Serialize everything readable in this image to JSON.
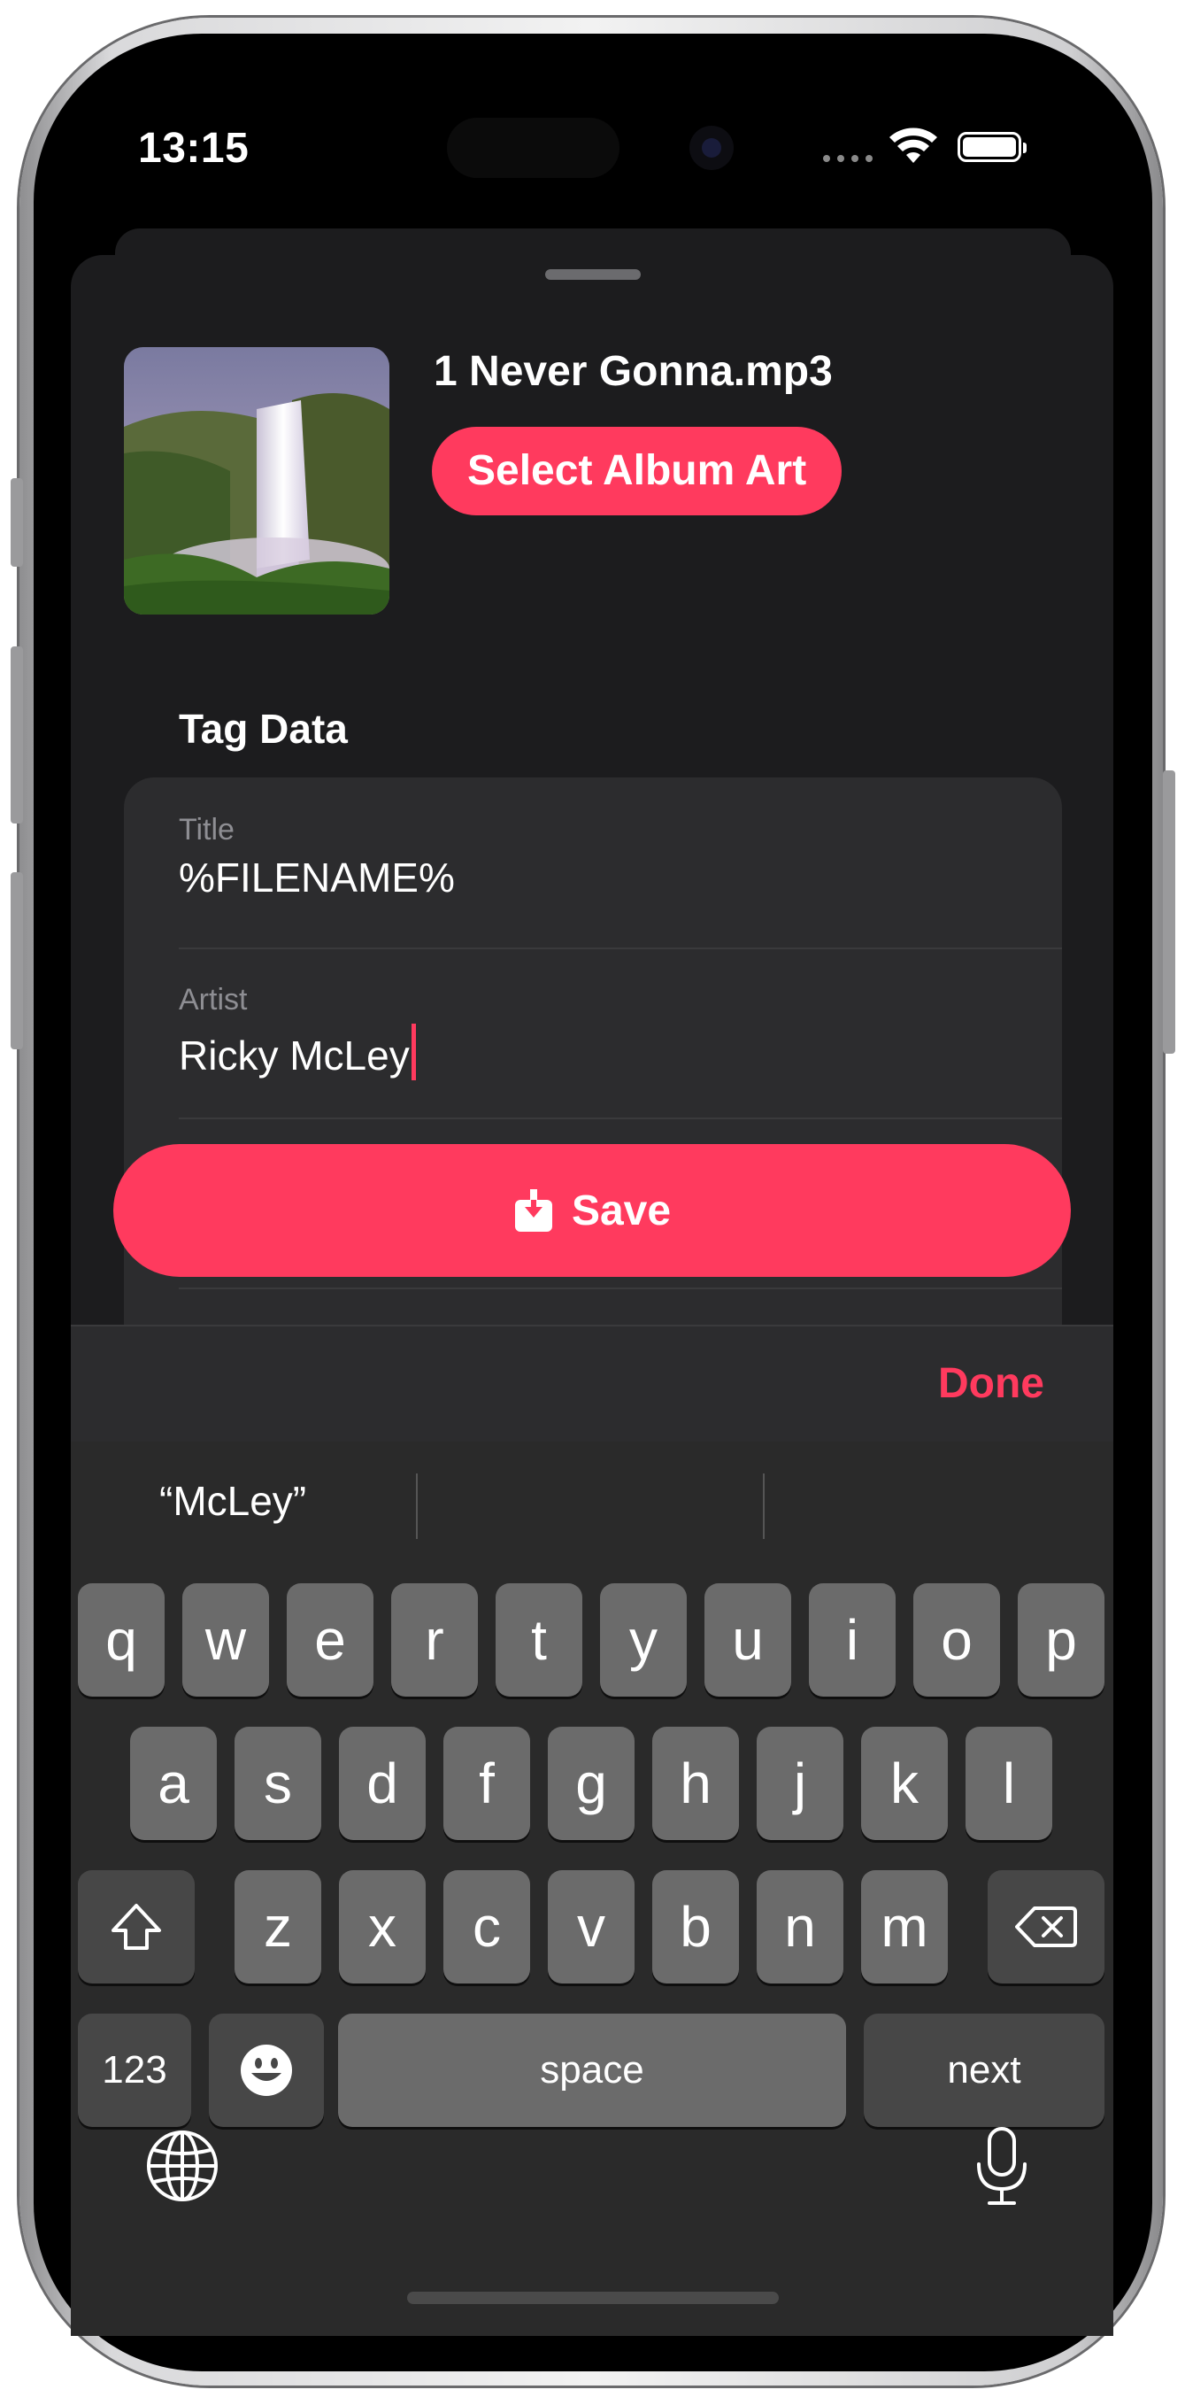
{
  "status_bar": {
    "time": "13:15"
  },
  "sheet": {
    "file_name": "1 Never Gonna.mp3",
    "select_album_art_label": "Select Album Art",
    "section_title": "Tag Data",
    "fields": [
      {
        "label": "Title",
        "value": "%FILENAME%"
      },
      {
        "label": "Artist",
        "value": "Ricky McLey"
      }
    ],
    "save_label": "Save"
  },
  "keyboard": {
    "done_label": "Done",
    "suggestion": "“McLey”",
    "row1": [
      "q",
      "w",
      "e",
      "r",
      "t",
      "y",
      "u",
      "i",
      "o",
      "p"
    ],
    "row2": [
      "a",
      "s",
      "d",
      "f",
      "g",
      "h",
      "j",
      "k",
      "l"
    ],
    "row3": [
      "z",
      "x",
      "c",
      "v",
      "b",
      "n",
      "m"
    ],
    "numbers_label": "123",
    "space_label": "space",
    "next_label": "next"
  },
  "colors": {
    "accent": "#ff3a5e",
    "sheet_bg": "#1c1c1e",
    "card_bg": "#2c2c2e"
  },
  "icons": [
    "wifi-icon",
    "battery-icon",
    "save-download-icon",
    "shift-icon",
    "delete-icon",
    "emoji-icon",
    "globe-icon",
    "microphone-icon"
  ]
}
